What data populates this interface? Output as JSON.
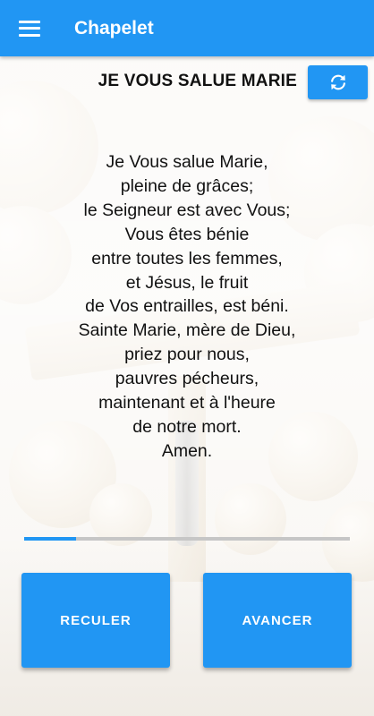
{
  "app_bar": {
    "title": "Chapelet",
    "menu_icon": "hamburger-menu-icon",
    "color": "#2196f3"
  },
  "prayer": {
    "title": "JE VOUS SALUE MARIE",
    "refresh_icon": "refresh-icon",
    "lines": [
      "Je Vous salue Marie,",
      "pleine de grâces;",
      "le Seigneur est avec Vous;",
      "Vous êtes bénie",
      "entre toutes les femmes,",
      "et Jésus, le fruit",
      "de Vos entrailles, est béni.",
      "Sainte Marie, mère de Dieu,",
      "priez pour nous,",
      "pauvres pécheurs,",
      "maintenant et à l'heure",
      "de notre mort.",
      "Amen."
    ]
  },
  "progress": {
    "fraction": 0.16,
    "fill_color": "#2196f3",
    "track_color": "#c6c6c6"
  },
  "buttons": {
    "back_label": "RECULER",
    "next_label": "AVANCER"
  }
}
